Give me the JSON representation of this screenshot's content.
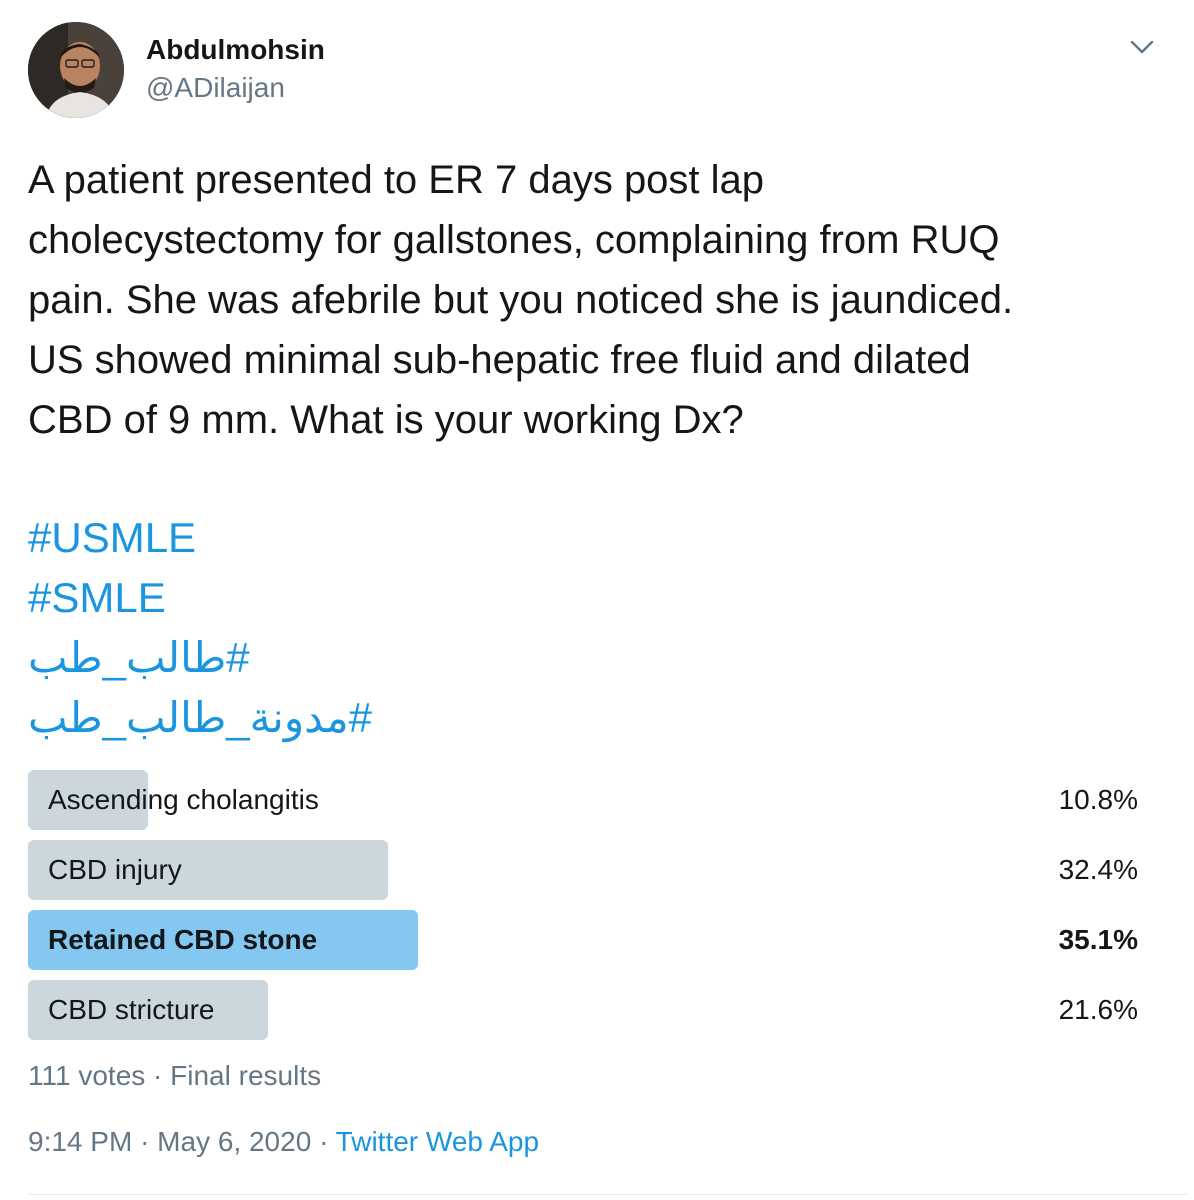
{
  "author": {
    "name": "Abdulmohsin",
    "handle": "@ADilaijan"
  },
  "tweet": {
    "text": "A patient presented to ER 7 days post lap\ncholecystectomy for gallstones, complaining from RUQ\npain. She was afebrile but you noticed she is jaundiced.\nUS showed minimal sub-hepatic free fluid and dilated\nCBD of 9 mm. What is your working Dx?",
    "hashtags": [
      "#USMLE",
      "#SMLE",
      "#طالب_طب",
      "#مدونة_طالب_طب"
    ]
  },
  "poll": {
    "options": [
      {
        "label": "Ascending cholangitis",
        "percent_text": "10.8%",
        "percent": 10.8,
        "winner": false
      },
      {
        "label": "CBD injury",
        "percent_text": "32.4%",
        "percent": 32.4,
        "winner": false
      },
      {
        "label": "Retained CBD stone",
        "percent_text": "35.1%",
        "percent": 35.1,
        "winner": true
      },
      {
        "label": "CBD stricture",
        "percent_text": "21.6%",
        "percent": 21.6,
        "winner": false
      }
    ],
    "votes": "111 votes",
    "separator": "·",
    "status": "Final results"
  },
  "meta": {
    "time": "9:14 PM",
    "separator": "·",
    "date": "May 6, 2020",
    "source": "Twitter Web App"
  },
  "colors": {
    "text": "#14171a",
    "secondary": "#657786",
    "link": "#1b95e0",
    "poll_bar": "#ccd6dd",
    "poll_bar_winner": "#84c7f1"
  },
  "icons": {
    "avatar": "profile-photo",
    "caret": "chevron-down-icon"
  }
}
